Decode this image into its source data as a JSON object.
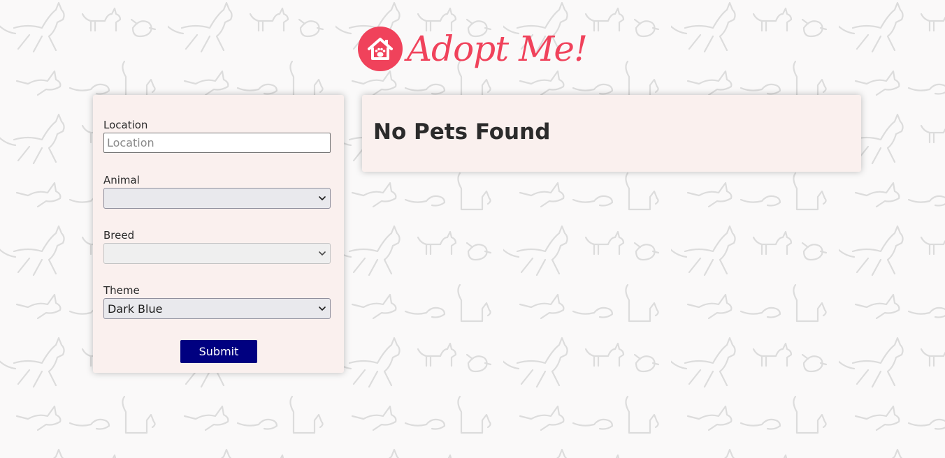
{
  "header": {
    "logo_text": "Adopt Me!",
    "logo_icon": "house-paw-icon",
    "brand_color": "#f0425b"
  },
  "search": {
    "location": {
      "label": "Location",
      "placeholder": "Location",
      "value": ""
    },
    "animal": {
      "label": "Animal",
      "selected": ""
    },
    "breed": {
      "label": "Breed",
      "selected": ""
    },
    "theme": {
      "label": "Theme",
      "selected": "Dark Blue",
      "color": "#000080"
    },
    "submit_label": "Submit"
  },
  "results": {
    "message": "No Pets Found"
  },
  "background": {
    "pattern_icon": "animal-doodle-pattern"
  }
}
